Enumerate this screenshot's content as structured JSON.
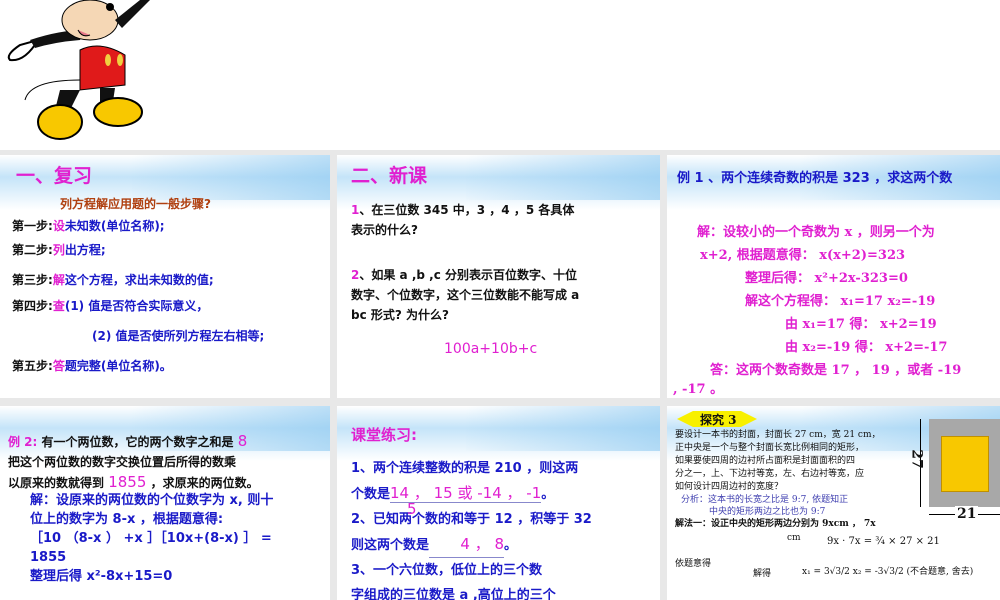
{
  "slides": [
    {
      "title": "一、复习",
      "subtitle": "列方程解应用题的一般步骤?",
      "steps": [
        {
          "label": "第一步:",
          "key": "设",
          "text": "未知数(单位名称);"
        },
        {
          "label": "第二步:",
          "key": "列",
          "text": "出方程;"
        },
        {
          "label": "第三步:",
          "key": "解",
          "text": "这个方程，求出未知数的值;"
        },
        {
          "label": "第四步:",
          "key": "查",
          "text": "(1) 值是否符合实际意义，"
        },
        {
          "label": "",
          "key": "",
          "text": "(2) 值是否使所列方程左右相等;"
        },
        {
          "label": "第五步:",
          "key": "答",
          "text": "题完整(单位名称)。"
        }
      ]
    },
    {
      "title": "二、新课",
      "q1_num": "1",
      "q1": "、在三位数 345 中，3 ，4 ，5 各具体",
      "q1b": "表示的什么?",
      "q2_num": "2",
      "q2": "、如果 a ,b ,c 分别表示百位数字、十位",
      "q2b": "数字、个位数字，这个三位数能不能写成 a",
      "q2c": "bc 形式? 为什么?",
      "answer": "100a+10b+c"
    },
    {
      "title": "例 1 、两个连续奇数的积是 323 ，求这两个数",
      "lines": [
        "解：设较小的一个奇数为 x ，则另一个为",
        "x+2,        根据题意得：  x(x+2)=323",
        "整理后得：  x²+2x-323=0",
        "解这个方程得：  x₁=17    x₂=-19",
        "由 x₁=17  得：  x+2=19",
        "由   x₂=-19  得：  x+2=-17",
        "答：这两个数奇数是 17 ， 19 ，或者 -19",
        ", -17 。"
      ]
    },
    {
      "label": "例 2:",
      "q1": "有一个两位数，它的两个数字之和是",
      "q1n": "8",
      "q2": "把这个两位数的数字交换位置后所得的数乘",
      "q3a": "以原来的数就得到",
      "q3n": "1855",
      "q3b": "，求原来的两位数。",
      "lines": [
        "解：设原来的两位数的个位数字为 x, 则十",
        "位上的数字为 8-x ，根据题意得:",
        "［10 （8-x ） +x ］［10x+(8-x) ］ =",
        "1855",
        "整理后得      x²-8x+15=0"
      ]
    },
    {
      "title": "课堂练习:",
      "p1": "1、两个连续整数的积是 210 ，则这两",
      "p1b": "个数是",
      "a1": "14 ， 15 或 -14 ， -1",
      "a1b": "5",
      "p1end": "。",
      "p2": "2、已知两个数的和等于 12 ，积等于 32",
      "p2b": "则这两个数是",
      "a2": "4 ， 8",
      "p2end": "。",
      "p3": "3、一个六位数，低位上的三个数",
      "p3b": "字组成的三位数是 a ,高位上的三个"
    },
    {
      "badge": "探究 3",
      "lines": [
        "要设计一本书的封面，封面长 27 cm，宽 21 cm，",
        "正中央是一个与整个封面长宽比例相同的矩形，",
        "如果要使四周的边衬所占面积是封面面积的四",
        "分之一，上、下边衬等宽，左、右边衬等宽，应",
        "如何设计四周边衬的宽度？"
      ],
      "analysis1": "分析：这本书的长宽之比是 9:7, 依题知正",
      "analysis2": "中央的矩形两边之比也为 9:7",
      "method": "解法一：设正中央的矩形两边分别为 9xcm ，    7x",
      "cm": "cm",
      "eq": "9x · 7x = ¾ × 27 × 21",
      "yiti": "依题意得",
      "jiede": "解得",
      "sol": "x₁ = 3√3/2    x₂ = -3√3/2 (不合题意, 舍去)",
      "dim_h": "27",
      "dim_w": "21"
    }
  ],
  "colors": {
    "magenta": "#e020d0",
    "blue": "#1a1ac8",
    "yellow": "#f8c800"
  }
}
